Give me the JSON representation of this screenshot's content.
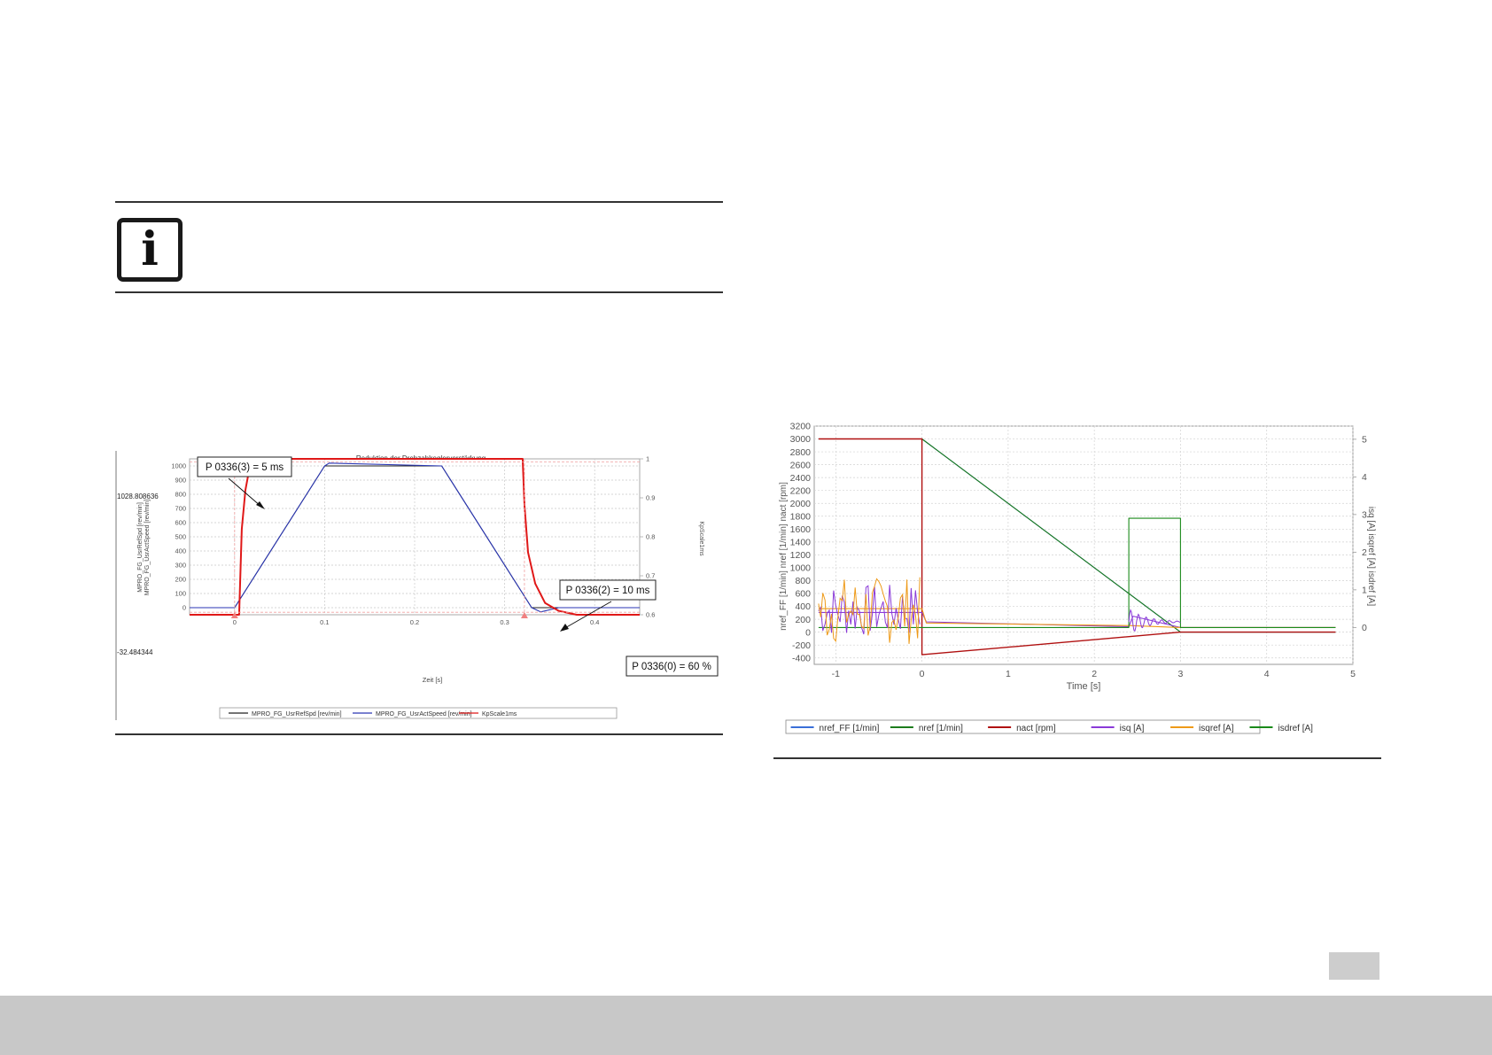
{
  "info_icon": {
    "glyph": "i",
    "icon": "info-icon"
  },
  "chart_data": [
    {
      "type": "line",
      "title": "Reduktion der Drehzahlreglerverstärkung",
      "xlabel": "Zeit [s]",
      "ylabel": "MPRO_FG_UsrRefSpd [rev/min]\nMPRO_FG_UsrActSpeed [rev/min]",
      "y2label": "KpScale1ms",
      "xlim": [
        -0.05,
        0.45
      ],
      "ylim": [
        -50,
        1050
      ],
      "y2lim": [
        0.6,
        1.0
      ],
      "x_ticks": [
        "0",
        "0.1",
        "0.2",
        "0.3",
        "0.4"
      ],
      "y_ticks": [
        "0",
        "100",
        "200",
        "300",
        "400",
        "500",
        "600",
        "700",
        "800",
        "900",
        "1000"
      ],
      "y2_ticks": [
        "0.6",
        "0.7",
        "0.8",
        "0.9",
        "1"
      ],
      "cursor_labels": {
        "top": "1028.808636",
        "bottom": "-32.484344"
      },
      "grid": true,
      "legend": "bottom",
      "annotations": [
        {
          "text": "P 0336(3) = 5 ms"
        },
        {
          "text": "P 0336(2) = 10 ms"
        },
        {
          "text": "P 0336(0) = 60 %"
        }
      ],
      "series": [
        {
          "name": "MPRO_FG_UsrRefSpd [rev/min]",
          "color": "#222222",
          "x": [
            -0.05,
            0.0,
            0.1,
            0.23,
            0.33,
            0.45
          ],
          "y": [
            0,
            0,
            1000,
            1000,
            0,
            0
          ]
        },
        {
          "name": "MPRO_FG_UsrActSpeed [rev/min]",
          "color": "#2a36b4",
          "x": [
            -0.05,
            0.0,
            0.1,
            0.105,
            0.23,
            0.33,
            0.34,
            0.36,
            0.45
          ],
          "y": [
            0,
            0,
            1000,
            1020,
            1000,
            0,
            -30,
            0,
            0
          ]
        },
        {
          "name": "KpScale1ms",
          "color": "#e01818",
          "axis": "y2",
          "x": [
            -0.05,
            0.005,
            0.008,
            0.012,
            0.016,
            0.022,
            0.03,
            0.32,
            0.322,
            0.326,
            0.334,
            0.345,
            0.36,
            0.38,
            0.45
          ],
          "y": [
            0.6,
            0.6,
            0.82,
            0.92,
            0.97,
            0.99,
            1.0,
            1.0,
            0.88,
            0.76,
            0.68,
            0.63,
            0.61,
            0.6,
            0.6
          ]
        }
      ]
    },
    {
      "type": "line",
      "xlabel": "Time [s]",
      "ylabel": "nref_FF [1/min]   nref [1/min]   nact [rpm]",
      "y2label": "isq [A]   isqref [A]   isdref [A]",
      "xlim": [
        -1.25,
        5.0
      ],
      "ylim": [
        -500,
        3200
      ],
      "y2lim": [
        -0.98,
        5.35
      ],
      "x_ticks": [
        "-1",
        "0",
        "1",
        "2",
        "3",
        "4",
        "5"
      ],
      "y_ticks": [
        "3200",
        "3000",
        "2800",
        "2600",
        "2400",
        "2200",
        "2000",
        "1800",
        "1600",
        "1400",
        "1200",
        "1000",
        "800",
        "600",
        "400",
        "200",
        "0",
        "-200",
        "-400"
      ],
      "y2_ticks": [
        "5",
        "4",
        "3",
        "2",
        "1",
        "0"
      ],
      "grid": true,
      "legend": "bottom",
      "series": [
        {
          "name": "nref_FF [1/min]",
          "color": "#3a6fd8",
          "x": [
            -1.2,
            0.0,
            3.0,
            4.8
          ],
          "y": [
            3000,
            3000,
            0,
            0
          ]
        },
        {
          "name": "nref [1/min]",
          "color": "#1c7c1c",
          "x": [
            -1.2,
            0.0,
            3.0,
            4.8
          ],
          "y": [
            3000,
            3000,
            0,
            0
          ]
        },
        {
          "name": "nact [rpm]",
          "color": "#b01010",
          "x": [
            -1.2,
            0.0,
            0.0,
            3.0,
            4.8
          ],
          "y": [
            3000,
            3000,
            -350,
            0,
            0
          ]
        },
        {
          "name": "isq [A]",
          "color": "#8a3ad8",
          "axis": "y2",
          "x": [
            -1.2,
            0.0,
            0.05,
            2.4,
            2.45,
            3.0,
            4.8
          ],
          "y": [
            0.4,
            0.4,
            0.15,
            0.02,
            0.3,
            0.0,
            0.0
          ]
        },
        {
          "name": "isqref [A]",
          "color": "#ee9a18",
          "axis": "y2",
          "x": [
            -1.2,
            0.0,
            0.05,
            2.4,
            3.0,
            4.8
          ],
          "y": [
            0.5,
            0.5,
            0.12,
            0.05,
            0.0,
            0.0
          ]
        },
        {
          "name": "isdref [A]",
          "color": "#1a8a1a",
          "axis": "y2",
          "x": [
            -1.2,
            2.4,
            2.4,
            3.0,
            3.0,
            4.8
          ],
          "y": [
            0.0,
            0.0,
            2.9,
            2.9,
            0.0,
            0.0
          ]
        }
      ]
    }
  ]
}
